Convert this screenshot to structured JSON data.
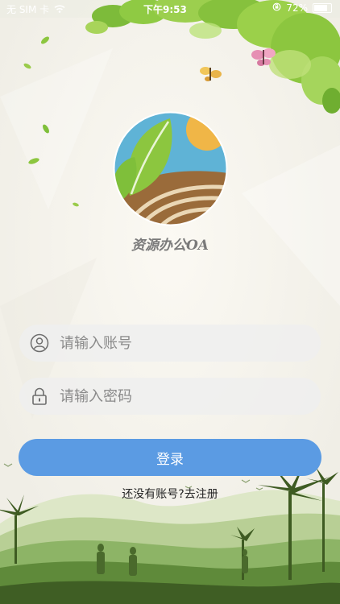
{
  "status_bar": {
    "carrier": "无 SIM 卡",
    "time": "下午9:53",
    "battery": "72%",
    "wifi_icon": "wifi-icon",
    "lock_icon": "orientation-lock-icon"
  },
  "app": {
    "name": "资源办公OA",
    "logo_icon": "leaf-field-sun-logo"
  },
  "form": {
    "account_placeholder": "请输入账号",
    "account_value": "",
    "account_icon": "user-icon",
    "password_placeholder": "请输入密码",
    "password_value": "",
    "password_icon": "lock-icon",
    "login_label": "登录",
    "register_prompt": "还没有账号?",
    "register_link": "去注册"
  },
  "colors": {
    "accent": "#5b9be3",
    "field_bg": "#eeeeee",
    "leaf_green": "#8cc63f",
    "sky_blue": "#5fb3d6",
    "sun": "#f0b647",
    "soil": "#9a6b3a"
  }
}
